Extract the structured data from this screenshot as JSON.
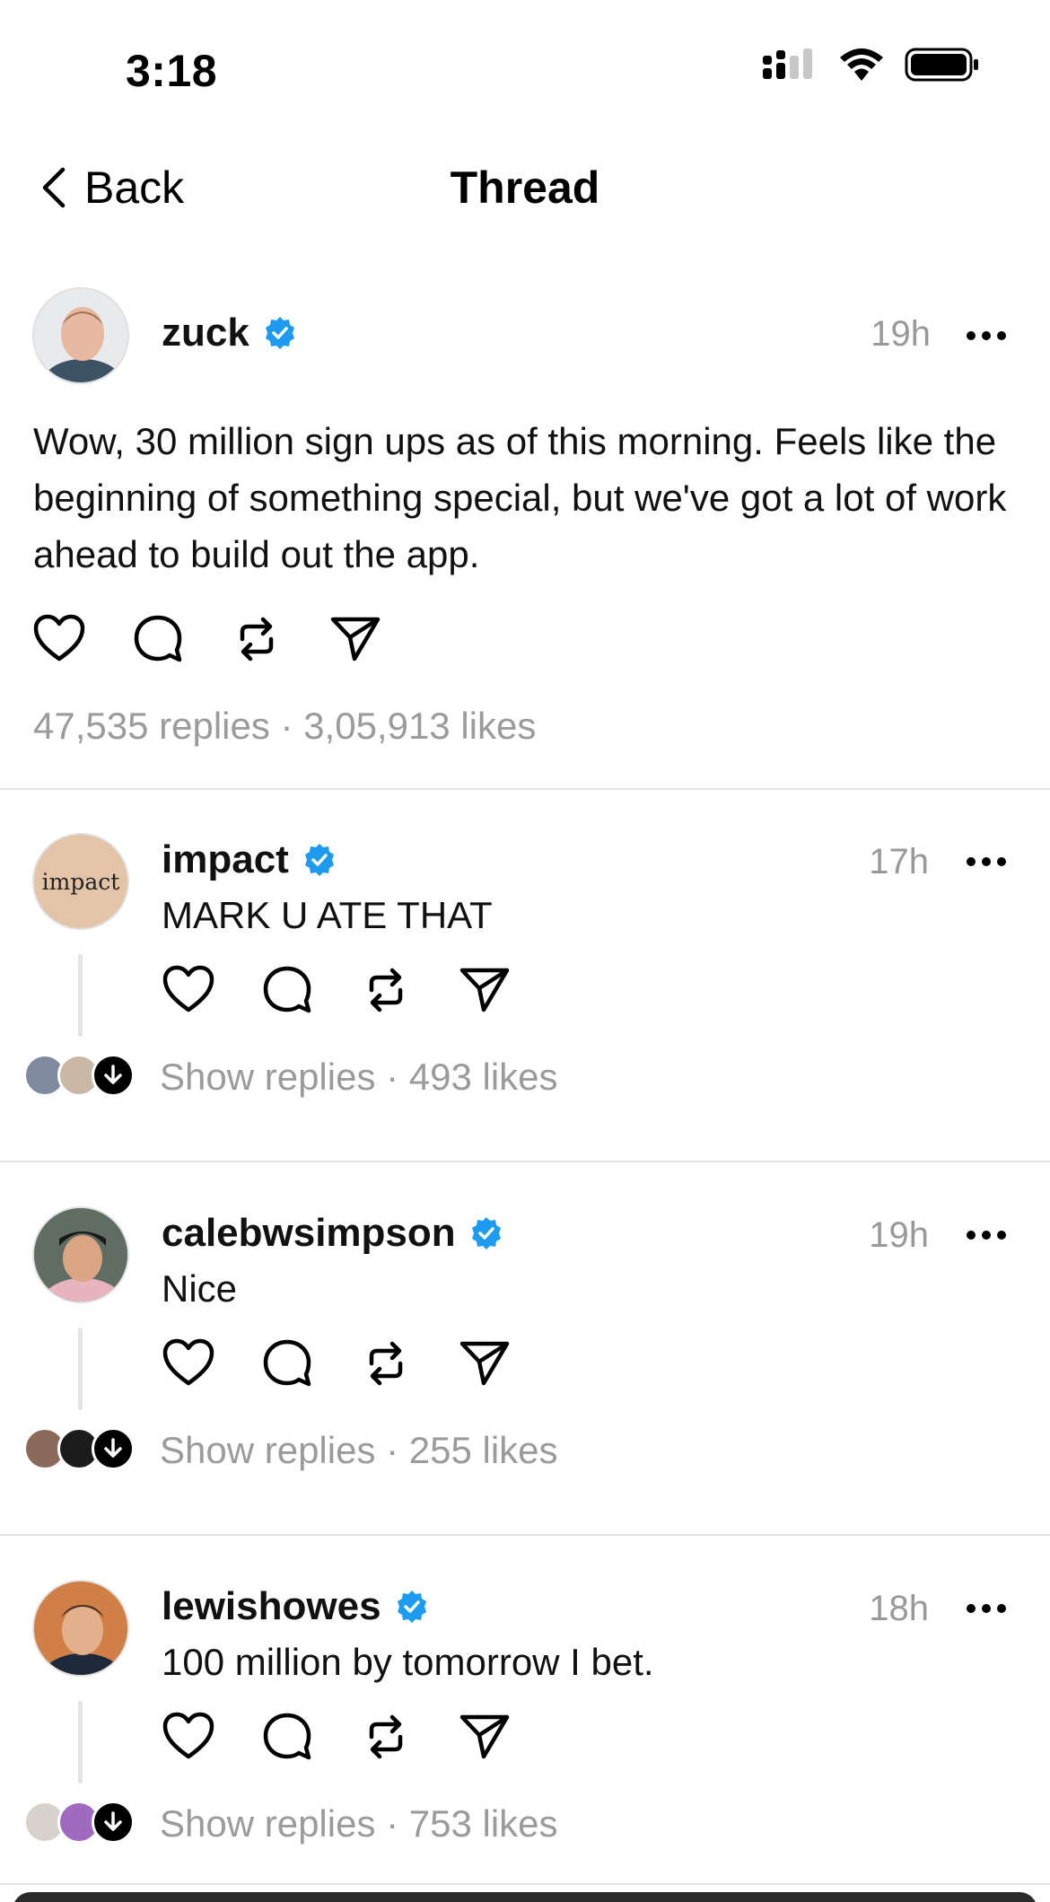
{
  "status_bar": {
    "time": "3:18"
  },
  "nav": {
    "back_label": "Back",
    "title": "Thread"
  },
  "post": {
    "username": "zuck",
    "time": "19h",
    "text": "Wow, 30 million sign ups as of this morning. Feels like the beginning of something special, but we've got a lot of work ahead to build out the app.",
    "stats": "47,535 replies · 3,05,913 likes"
  },
  "replies": [
    {
      "username": "impact",
      "time": "17h",
      "text": "MARK U ATE THAT",
      "stats": "Show replies · 493 likes",
      "avatar_text": "impact"
    },
    {
      "username": "calebwsimpson",
      "time": "19h",
      "text": "Nice",
      "stats": "Show replies · 255 likes"
    },
    {
      "username": "lewishowes",
      "time": "18h",
      "text": "100 million by tomorrow I bet.",
      "stats": "Show replies · 753 likes"
    }
  ],
  "colors": {
    "verified": "#1d9bf0",
    "muted": "#9b9b9b",
    "divider": "#e2e2e2"
  },
  "icons": [
    "back-chevron-icon",
    "signal-icon",
    "wifi-icon",
    "battery-icon",
    "verified-badge-icon",
    "more-icon",
    "heart-icon",
    "comment-icon",
    "repost-icon",
    "share-icon",
    "arrow-down-icon"
  ]
}
